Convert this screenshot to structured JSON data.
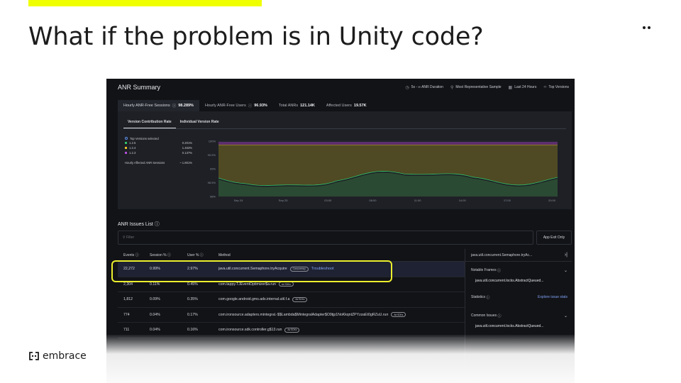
{
  "slide": {
    "title": "What if the problem is in Unity code?",
    "logo_text": "embrace",
    "accent_color": "#f0ff00"
  },
  "app": {
    "title": "ANR Summary",
    "controls": [
      {
        "icon": "clock-icon",
        "label": "5s - ∞ ANR Duration"
      },
      {
        "icon": "filter-icon",
        "label": "Most Representative Sample"
      },
      {
        "icon": "calendar-icon",
        "label": "Last 24 Hours"
      },
      {
        "icon": "code-icon",
        "label": "Top Versions"
      }
    ],
    "stats": [
      {
        "label": "Hourly ANR-Free Sessions",
        "value": "98.289%"
      },
      {
        "label": "Hourly ANR-Free Users",
        "value": "96.93%"
      },
      {
        "label": "Total ANRs",
        "value": "121.14K"
      },
      {
        "label": "Affected Users",
        "value": "19.57K"
      }
    ],
    "sub_tabs": [
      "Version Contribution Rate",
      "Individual Version Rate"
    ],
    "legend": {
      "selected_label": "Top Versions selected",
      "items": [
        {
          "name": "1.2.5",
          "value": "0.201%",
          "color": "#2fc26b"
        },
        {
          "name": "1.2.4",
          "value": "1.463%",
          "color": "#e6c02a"
        },
        {
          "name": "1.2.3",
          "value": "0.137%",
          "color": "#b34fd6"
        }
      ],
      "affected_label": "Hourly Affected ANR Sessions",
      "affected_value": "~ 1.801%"
    },
    "chart_data": {
      "type": "area",
      "y_ticks": [
        "100%",
        "99.5%",
        "99%",
        "98.5%",
        "98%"
      ],
      "x_ticks": [
        "Sep 24",
        "Sep 25",
        "03:00",
        "08:00",
        "11:00",
        "14:00",
        "17:00",
        "20:00"
      ],
      "series": [
        {
          "name": "1.2.5",
          "color": "#2fc26b"
        },
        {
          "name": "1.2.4",
          "color": "#e6c02a"
        },
        {
          "name": "1.2.3",
          "color": "#b34fd6"
        }
      ]
    },
    "issues": {
      "title": "ANR Issues List",
      "filter_placeholder": "Filter",
      "app_exit_label": "App Exit Only",
      "columns": [
        "Events",
        "Session %",
        "User %",
        "Method"
      ],
      "rows": [
        {
          "events": "22,272",
          "session": "0.99%",
          "user": "2.97%",
          "method": "java.util.concurrent.Semaphore.tryAcquire",
          "tag": "Concurrency",
          "action": "Troubleshoot"
        },
        {
          "events": "2,304",
          "session": "0.11%",
          "user": "0.45%",
          "method": "com.tappy.TJEventOptimizer$a.run",
          "tag": "Ad SDKs"
        },
        {
          "events": "1,812",
          "session": "0.09%",
          "user": "0.35%",
          "method": "com.google.android.gms.ads.internal.util.f.a",
          "tag": "Ad SDKs"
        },
        {
          "events": "774",
          "session": "0.04%",
          "user": "0.17%",
          "method": "com.ironsource.adapters.mintegral.-$$Lambda$MintegralAdapter$O9tjp1NoKkqntZPYzzaEt0gRZuU.run",
          "tag": "Ad SDKs"
        },
        {
          "events": "711",
          "session": "0.04%",
          "user": "0.16%",
          "method": "com.ironsource.sdk.controller.g$13.run",
          "tag": "Ad SDKs"
        }
      ]
    },
    "side_panel": {
      "title": "java.util.concurrent.Semaphore.tryAc...",
      "notable_frames_label": "Notable Frames",
      "notable_frame": "java.util.concurrent.locks.AbstractQueued...",
      "statistics_label": "Statistics",
      "explore_label": "Explore issue stats",
      "common_issues_label": "Common Issues",
      "common_issue": "java.util.concurrent.locks.AbstractQueued..."
    }
  }
}
